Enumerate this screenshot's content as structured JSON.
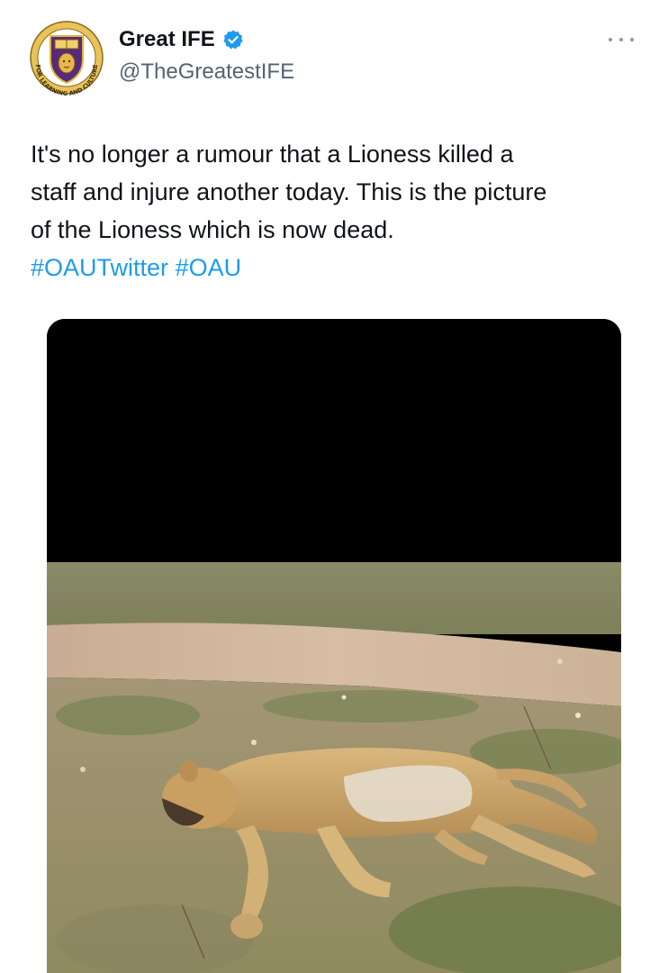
{
  "author": {
    "display_name": "Great IFE",
    "handle": "@TheGreatestIFE",
    "verified": true,
    "avatar_icon": "university-crest-icon",
    "avatar_motto": "FOR LEARNING AND CULTURE"
  },
  "tweet": {
    "text": "It's no longer a rumour that a Lioness killed a\nstaff and injure another today. This is the picture\nof the Lioness which is now dead.",
    "hashtags": [
      "#OAUTwitter",
      "#OAU"
    ]
  },
  "media": {
    "subject_icon": "lioness-photo",
    "censor_color": "#000000"
  },
  "colors": {
    "link": "#1d9bf0",
    "verified": "#1d9bf0",
    "secondary_text": "#536471"
  }
}
